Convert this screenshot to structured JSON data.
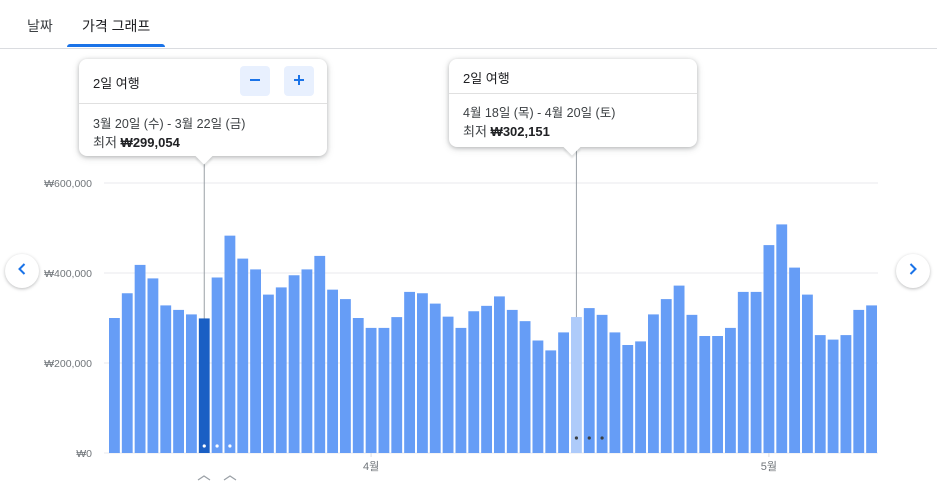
{
  "tabs": [
    {
      "label": "날짜",
      "active": false
    },
    {
      "label": "가격 그래프",
      "active": true
    }
  ],
  "colors": {
    "bar": "#669df6",
    "bar_selected": "#1a5fc4",
    "bar_hover": "#aecbfa",
    "accent": "#1a73e8"
  },
  "left_card": {
    "trip_length": "2일 여행",
    "dates": "3월 20일 (수) - 3월 22일 (금)",
    "low_label": "최저",
    "low_price": "₩299,054",
    "minus_icon": "minus-icon",
    "plus_icon": "plus-icon"
  },
  "right_card": {
    "trip_length": "2일 여행",
    "dates": "4월 18일 (목) - 4월 20일 (토)",
    "low_label": "최저",
    "low_price": "₩302,151"
  },
  "nav": {
    "prev_icon": "chevron-left-icon",
    "next_icon": "chevron-right-icon"
  },
  "chart_data": {
    "type": "bar",
    "ylim": [
      0,
      600000
    ],
    "y_ticks": [
      {
        "value": 0,
        "label": "₩0"
      },
      {
        "value": 200000,
        "label": "₩200,000"
      },
      {
        "value": 400000,
        "label": "₩400,000"
      },
      {
        "value": 600000,
        "label": "₩600,000"
      }
    ],
    "x_ticks": [
      {
        "index": 20,
        "label": "4월"
      },
      {
        "index": 51,
        "label": "5월"
      }
    ],
    "values": [
      300000,
      355000,
      418000,
      388000,
      328000,
      318000,
      308000,
      299054,
      390000,
      483000,
      432000,
      408000,
      352000,
      368000,
      395000,
      408000,
      438000,
      363000,
      342000,
      300000,
      278000,
      278000,
      302000,
      358000,
      355000,
      332000,
      303000,
      278000,
      315000,
      327000,
      348000,
      318000,
      293000,
      250000,
      228000,
      268000,
      302151,
      322000,
      307000,
      268000,
      240000,
      248000,
      308000,
      342000,
      372000,
      307000,
      260000,
      260000,
      278000,
      358000,
      358000,
      462000,
      508000,
      412000,
      352000,
      262000,
      252000,
      262000,
      318000,
      328000
    ],
    "selected_index": 7,
    "hover_index": 36,
    "grid": true
  }
}
